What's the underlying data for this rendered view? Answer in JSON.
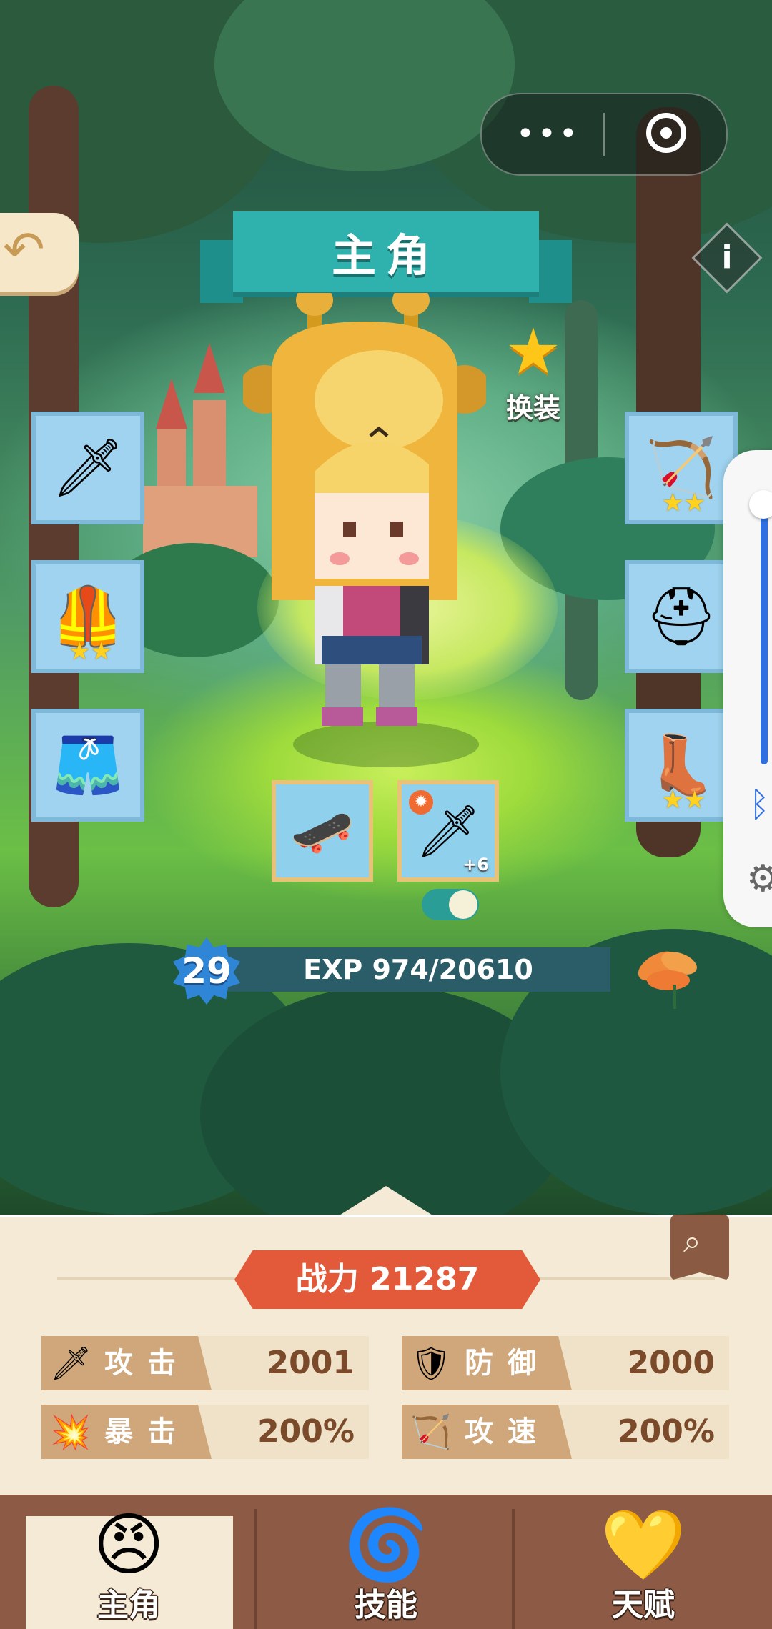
{
  "header": {
    "title": "主角",
    "menu_dots": "•••"
  },
  "outfit": {
    "label": "换装"
  },
  "equipment": {
    "left": [
      {
        "name": "sword",
        "icon": "🗡",
        "stars": ""
      },
      {
        "name": "armor",
        "icon": "🦺",
        "stars": "★★"
      },
      {
        "name": "pants",
        "icon": "🩳",
        "stars": ""
      }
    ],
    "right": [
      {
        "name": "bow",
        "icon": "🏹",
        "stars": "★★"
      },
      {
        "name": "helmet",
        "icon": "⛑",
        "stars": ""
      },
      {
        "name": "boots",
        "icon": "👢",
        "stars": "★★"
      }
    ],
    "quick": [
      {
        "name": "skateboard",
        "icon": "🛹",
        "plus": ""
      },
      {
        "name": "dagger",
        "icon": "🗡",
        "plus": "+6"
      }
    ]
  },
  "level": {
    "value": "29",
    "exp_text": "EXP 974/20610"
  },
  "stats": {
    "power_label": "战力 21287",
    "items": [
      {
        "name": "攻击",
        "value": "2001",
        "icon": "🗡"
      },
      {
        "name": "防御",
        "value": "2000",
        "icon": "🛡"
      },
      {
        "name": "暴击",
        "value": "200%",
        "icon": "💥"
      },
      {
        "name": "攻速",
        "value": "200%",
        "icon": "🏹"
      }
    ]
  },
  "tabs": [
    {
      "label": "主角",
      "icon": "😠",
      "active": true
    },
    {
      "label": "技能",
      "icon": "🌀",
      "active": false
    },
    {
      "label": "天赋",
      "icon": "💛",
      "active": false
    }
  ],
  "colors": {
    "title_teal": "#2fb2ad",
    "power_red": "#e35a3a",
    "tab_brown": "#8d5b45",
    "panel_cream": "#f4ead5"
  }
}
